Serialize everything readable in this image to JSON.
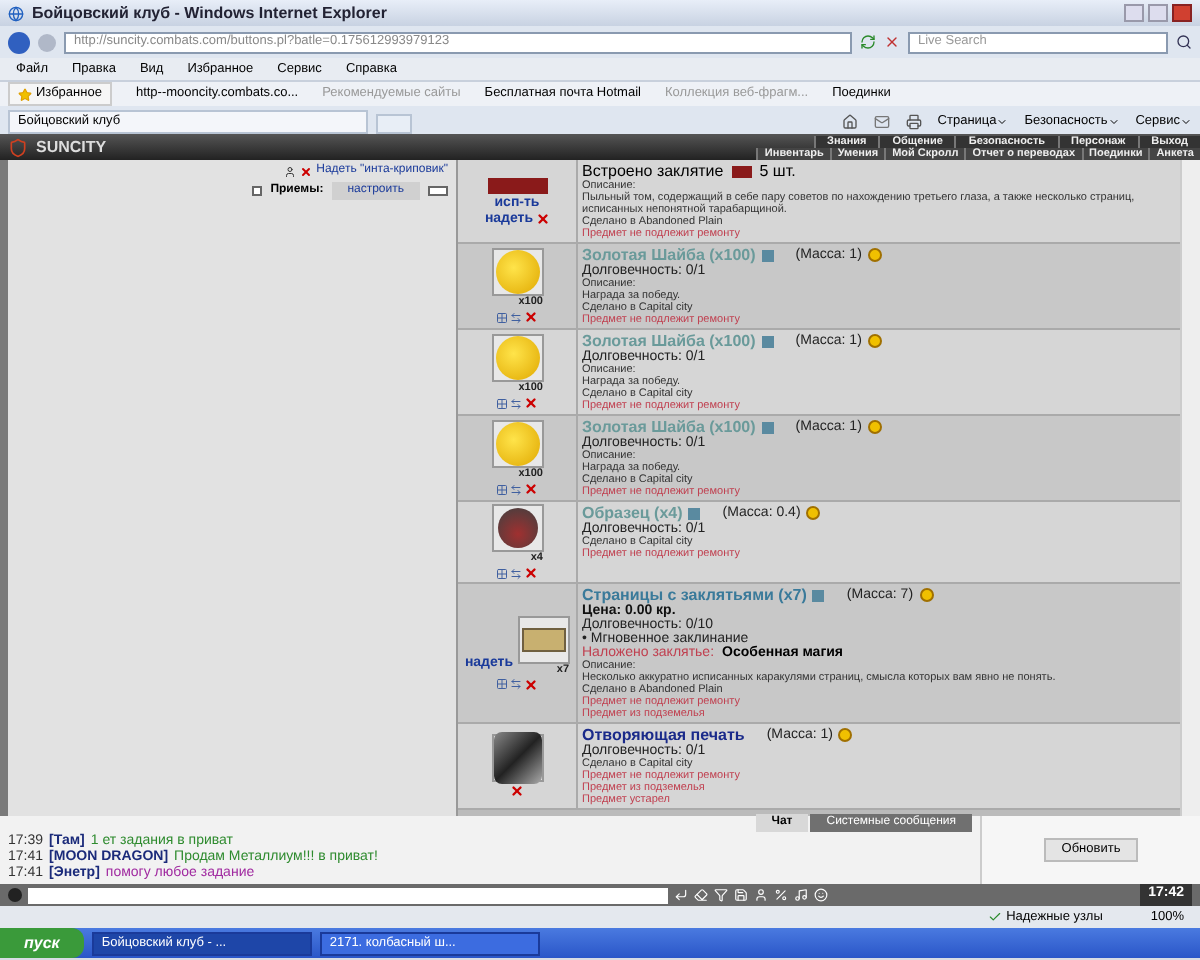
{
  "window": {
    "title": "Бойцовский клуб - Windows Internet Explorer"
  },
  "address_bar": {
    "url": "http://suncity.combats.com/buttons.pl?batle=0.175612993979123"
  },
  "search": {
    "placeholder": "Live Search"
  },
  "menu": [
    "Файл",
    "Правка",
    "Вид",
    "Избранное",
    "Сервис",
    "Справка"
  ],
  "favorites_bar": {
    "favorites_button": "Избранное",
    "links": [
      "http--mooncity.combats.co...",
      "Рекомендуемые сайты",
      "Бесплатная почта Hotmail",
      "Коллекция веб-фрагм...",
      "Поединки"
    ]
  },
  "tab": {
    "title": "Бойцовский клуб"
  },
  "command_bar": [
    "Страница",
    "Безопасность",
    "Сервис"
  ],
  "game_header": {
    "logo": "SUNCITY",
    "nav_top": [
      "Знания",
      "Общение",
      "Безопасность",
      "Персонаж",
      "Выход"
    ],
    "nav_bottom": [
      "Инвентарь",
      "Умения",
      "Мой Скролл",
      "Отчет о переводах",
      "Поединки",
      "Анкета"
    ]
  },
  "left_panel": {
    "equip_link": "Надеть \"инта-криповик\"",
    "techniques_label": "Приемы:",
    "techniques_link": "настроить"
  },
  "items": [
    {
      "kind": "book",
      "actions": [
        "исп-ть",
        "надеть"
      ],
      "lines": [
        {
          "kind": "embedded",
          "text": "Встроено заклятие",
          "value": "5 шт."
        },
        {
          "kind": "small",
          "text": "Описание:"
        },
        {
          "kind": "small",
          "text": "Пыльный том, содержащий в себе пару советов по нахождению третьего глаза, а также несколько страниц, исписанных непонятной тарабарщиной."
        },
        {
          "kind": "small",
          "text": "Сделано в Abandoned Plain"
        },
        {
          "kind": "warn",
          "text": "Предмет не подлежит ремонту"
        }
      ]
    },
    {
      "kind": "coin",
      "badge": "x100",
      "name": "Золотая Шайба (x100)",
      "mass": "(Масса: 1)",
      "lines": [
        {
          "kind": "durability",
          "text": "Долговечность: 0/1"
        },
        {
          "kind": "small",
          "text": "Описание:"
        },
        {
          "kind": "small",
          "text": "Награда за победу."
        },
        {
          "kind": "small",
          "text": "Сделано в Capital city"
        },
        {
          "kind": "warn",
          "text": "Предмет не подлежит ремонту"
        }
      ]
    },
    {
      "kind": "coin",
      "badge": "x100",
      "name": "Золотая Шайба (x100)",
      "mass": "(Масса: 1)",
      "lines": [
        {
          "kind": "durability",
          "text": "Долговечность: 0/1"
        },
        {
          "kind": "small",
          "text": "Описание:"
        },
        {
          "kind": "small",
          "text": "Награда за победу."
        },
        {
          "kind": "small",
          "text": "Сделано в Capital city"
        },
        {
          "kind": "warn",
          "text": "Предмет не подлежит ремонту"
        }
      ]
    },
    {
      "kind": "coin",
      "badge": "x100",
      "name": "Золотая Шайба (x100)",
      "mass": "(Масса: 1)",
      "lines": [
        {
          "kind": "durability",
          "text": "Долговечность: 0/1"
        },
        {
          "kind": "small",
          "text": "Описание:"
        },
        {
          "kind": "small",
          "text": "Награда за победу."
        },
        {
          "kind": "small",
          "text": "Сделано в Capital city"
        },
        {
          "kind": "warn",
          "text": "Предмет не подлежит ремонту"
        }
      ]
    },
    {
      "kind": "flask",
      "badge": "x4",
      "name": "Образец (x4)",
      "mass": "(Масса: 0.4)",
      "lines": [
        {
          "kind": "durability",
          "text": "Долговечность: 0/1"
        },
        {
          "kind": "small",
          "text": "Сделано в Capital city"
        },
        {
          "kind": "warn",
          "text": "Предмет не подлежит ремонту"
        }
      ]
    },
    {
      "kind": "pages",
      "badge": "x7",
      "actions": [
        "надеть"
      ],
      "name": "Страницы с заклятьями (x7)",
      "mass": "(Масса: 7)",
      "lines": [
        {
          "kind": "price",
          "text": "Цена: 0.00 кр."
        },
        {
          "kind": "durability",
          "text": "Долговечность: 0/10"
        },
        {
          "kind": "durability",
          "text": "• Мгновенное заклинание"
        },
        {
          "kind": "spell",
          "text": "Наложено заклятье:",
          "value": "Особенная магия"
        },
        {
          "kind": "small",
          "text": "Описание:"
        },
        {
          "kind": "small",
          "text": "Несколько аккуратно исписанных каракулями страниц, смысла которых вам явно не понять."
        },
        {
          "kind": "small",
          "text": "Сделано в Abandoned Plain"
        },
        {
          "kind": "warn",
          "text": "Предмет не подлежит ремонту"
        },
        {
          "kind": "warn",
          "text": "Предмет из подземелья"
        }
      ]
    },
    {
      "kind": "seal",
      "name": "Отворяющая печать",
      "mass": "(Масса: 1)",
      "lines": [
        {
          "kind": "durability",
          "text": "Долговечность: 0/1"
        },
        {
          "kind": "small",
          "text": "Сделано в Capital city"
        },
        {
          "kind": "warn",
          "text": "Предмет не подлежит ремонту"
        },
        {
          "kind": "warn",
          "text": "Предмет из подземелья"
        },
        {
          "kind": "warn",
          "text": "Предмет устарел"
        }
      ]
    }
  ],
  "chat": {
    "messages": [
      {
        "time": "17:39",
        "nick": "[Там]",
        "text": "1 ет задания в приват",
        "color": "#2e8b2e"
      },
      {
        "time": "17:41",
        "nick": "[MOON DRAGON]",
        "text": "Продам Металлиум!!! в приват!",
        "color": "#2e8b2e"
      },
      {
        "time": "17:41",
        "nick": "[Энетр]",
        "text": "помогу любое задание",
        "color": "#a02aa0"
      }
    ],
    "tabs": [
      {
        "label": "Чат",
        "selected": true
      },
      {
        "label": "Системные сообщения",
        "selected": false
      }
    ],
    "refresh_button": "Обновить",
    "clock": "17:42"
  },
  "status_bar": {
    "zone": "Надежные узлы",
    "zoom": "100%"
  },
  "taskbar": {
    "start": "пуск",
    "tasks": [
      {
        "label": "Бойцовский клуб - ...",
        "selected": true
      },
      {
        "label": "2171. колбасный ш...",
        "selected": false
      }
    ]
  }
}
